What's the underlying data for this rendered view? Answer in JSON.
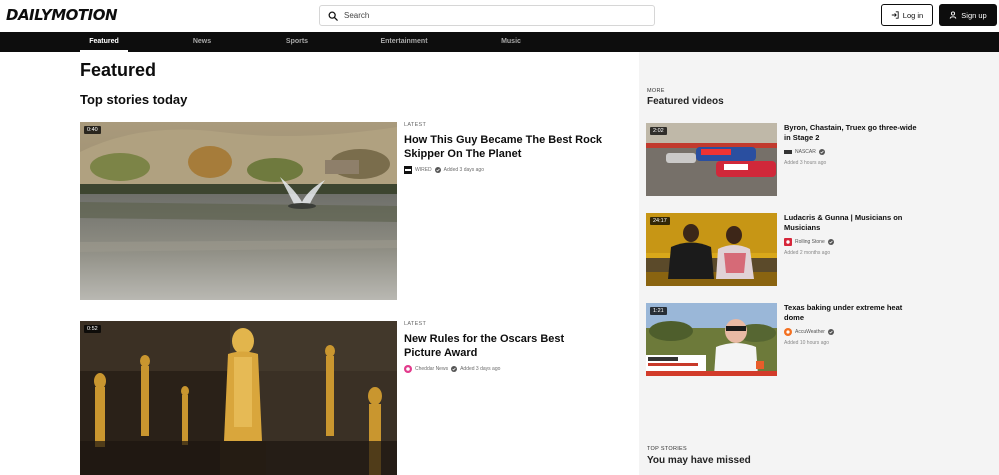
{
  "header": {
    "logo": "DAILYMOTION",
    "search_placeholder": "Search",
    "login_label": "Log in",
    "signup_label": "Sign up"
  },
  "nav": {
    "items": [
      {
        "label": "Featured",
        "active": true
      },
      {
        "label": "News"
      },
      {
        "label": "Sports"
      },
      {
        "label": "Entertainment"
      },
      {
        "label": "Music"
      }
    ]
  },
  "main": {
    "page_title": "Featured",
    "section_title": "Top stories today",
    "stories": [
      {
        "duration": "0:40",
        "tag": "LATEST",
        "title": "How This Guy Became The Best Rock Skipper On The Planet",
        "channel": "WIRED",
        "added": "Added 3 days ago"
      },
      {
        "duration": "0:52",
        "tag": "LATEST",
        "title": "New Rules for the Oscars Best Picture Award",
        "channel": "Cheddar News",
        "added": "Added 3 days ago"
      }
    ]
  },
  "sidebar": {
    "more_label": "MORE",
    "featured_title": "Featured videos",
    "videos": [
      {
        "duration": "2:02",
        "title": "Byron, Chastain, Truex go three-wide in Stage 2",
        "channel": "NASCAR",
        "added": "Added 3 hours ago"
      },
      {
        "duration": "24:17",
        "title": "Ludacris & Gunna | Musicians on Musicians",
        "channel": "Rolling Stone",
        "added": "Added 2 months ago"
      },
      {
        "duration": "1:21",
        "title": "Texas baking under extreme heat dome",
        "channel": "AccuWeather",
        "added": "Added 10 hours ago"
      }
    ],
    "top_stories_label": "TOP STORIES",
    "missed_title": "You may have missed"
  },
  "colors": {
    "brand_dark": "#0d0d0d",
    "sidebar_bg": "#f4f4f4"
  }
}
